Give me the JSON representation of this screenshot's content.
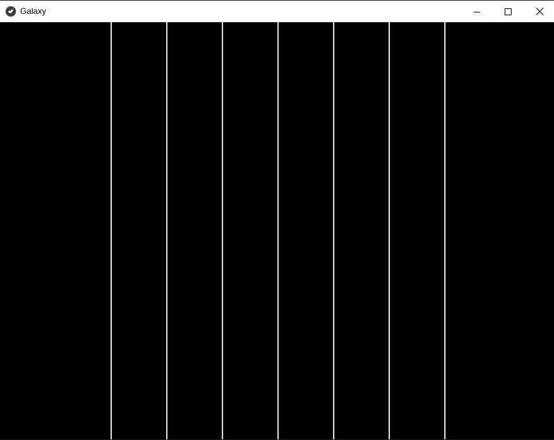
{
  "window": {
    "title": "Galaxy",
    "app_icon": "kivy-logo-icon",
    "controls": {
      "minimize_icon": "minimize-icon",
      "maximize_icon": "maximize-icon",
      "close_icon": "close-icon"
    }
  },
  "canvas": {
    "background_color": "#000000",
    "line_color": "#d9d9d9",
    "vertical_line_count": 7
  }
}
